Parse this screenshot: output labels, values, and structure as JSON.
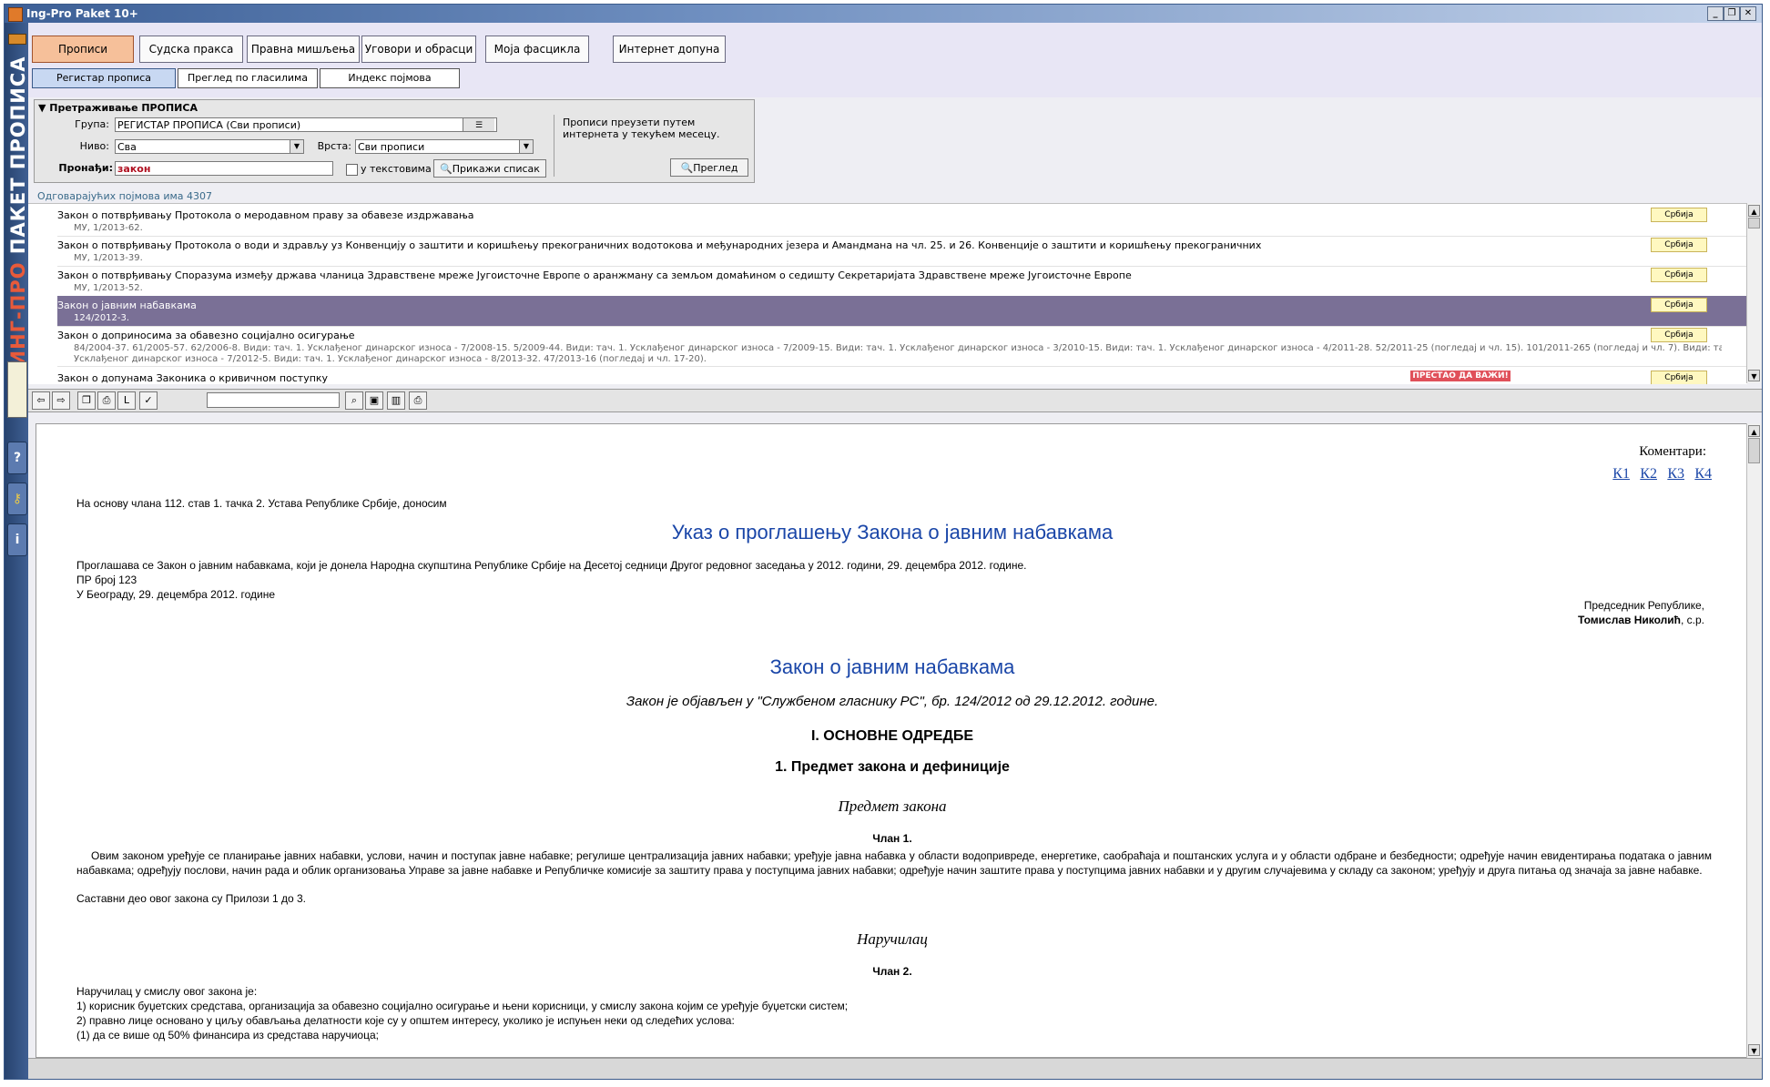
{
  "window": {
    "title": "Ing-Pro Paket 10+"
  },
  "sidebar": {
    "brand_part1": "ИНГ-ПРО",
    "brand_part2": " ПАКЕТ ПРОПИСА"
  },
  "main_tabs": [
    "Прописи",
    "Судска пракса",
    "Правна мишљења",
    "Уговори и обрасци",
    "Моја фасцикла",
    "Интернет допуна"
  ],
  "sub_tabs": [
    "Регистар прописа",
    "Преглед по гласилима",
    "Индекс појмова"
  ],
  "search": {
    "header": "Претраживање ПРОПИСА",
    "group_label": "Група:",
    "group_value": "РЕГИСТАР ПРОПИСА (Сви прописи)",
    "level_label": "Ниво:",
    "level_value": "Сва",
    "type_label": "Врста:",
    "type_value": "Сви прописи",
    "find_label": "Пронађи:",
    "find_value": "закон",
    "in_texts_label": "у текстовима",
    "show_list_button": "Прикажи списак",
    "note": "Прописи преузети путем интернета у текућем месецу.",
    "preview_button": "Преглед"
  },
  "result_count": "Одговарајућих појмова има 4307",
  "results": [
    {
      "title": "Закон о потврђивању Протокола о меродавном праву за обавезе издржавања",
      "ref": "МУ, 1/2013-62.",
      "region": "Србија"
    },
    {
      "title": "Закон о потврђивању Протокола о води и здрављу уз Конвенцију о заштити и коришћењу прекограничних водотокова и међународних језера и Амандмана на чл. 25. и 26. Конвенције о заштити и коришћењу прекограничних",
      "ref": "МУ, 1/2013-39.",
      "region": "Србија"
    },
    {
      "title": "Закон о потврђивању Споразума између држава чланица Здравствене мреже Југоисточне Европе о аранжману са земљом домаћином о седишту Секретаријата Здравствене мреже Југоисточне Европе",
      "ref": "МУ, 1/2013-52.",
      "region": "Србија"
    },
    {
      "title": "Закон о јавним набавкама",
      "ref": "124/2012-3.",
      "region": "Србија"
    },
    {
      "title": "Закон о доприносима за обавезно социјално осигурање",
      "ref": "84/2004-37. 61/2005-57. 62/2006-8. Види: тач. 1. Усклађеног динарског износа - 7/2008-15. 5/2009-44. Види: тач. 1. Усклађеног динарског износа - 7/2009-15. Види: тач. 1. Усклађеног динарског износа - 3/2010-15. Види: тач. 1. Усклађеног динарског износа - 4/2011-28. 52/2011-25 (погледај и чл. 15). 101/2011-265 (погледај и чл. 7). Види: тач. 1.",
      "ref2": "Усклађеног динарског износа - 7/2012-5. Види: тач. 1. Усклађеног динарског износа - 8/2013-32. 47/2013-16 (погледај и чл. 17-20).",
      "region": "Србија"
    },
    {
      "title": "Закон о допунама Законика о кривичном поступку",
      "ref": "",
      "region": "Србија",
      "status": "ПРЕСТАО ДА ВАЖИ!"
    }
  ],
  "toolbar_labels": {
    "arrow_back": "⇦",
    "arrow_fwd": "⇨",
    "l_button": "L"
  },
  "document": {
    "comments_label": "Коментари:",
    "comment_links": [
      "К1",
      "К2",
      "К3",
      "К4"
    ],
    "preamble": "На основу члана 112. став 1. тачка 2. Устава Републике Србије, доносим",
    "decree_title": "Указ о проглашењу Закона о јавним набавкама",
    "decree_line1": "Проглашава се Закон о јавним набавкама, који је донела Народна скупштина Републике Србије на Десетој седници Другог редовног заседања у 2012. години, 29. децембра 2012. године.",
    "decree_line2": "ПР број 123",
    "decree_line3": "У Београду, 29. децембра 2012. године",
    "president_title": "Председник Републике,",
    "president_name": "Томислав Николић",
    "president_suffix": ", с.р.",
    "law_title": "Закон о јавним набавкама",
    "published": "Закон је објављен у \"Службеном гласнику РС\", бр. 124/2012 од 29.12.2012. године.",
    "part_heading": "I. ОСНОВНЕ ОДРЕДБЕ",
    "chapter_heading": "1. Предмет закона и дефиниције",
    "sub1": "Предмет закона",
    "art1": "Члан 1.",
    "art1_text": "Овим законом уређује се планирање јавних набавки, услови, начин и поступак јавне набавке; регулише централизација јавних набавки; уређује јавна набавка у области водопривреде, енергетике, саобраћаја и поштанских услуга и у области одбране и безбедности; одређује начин евидентирања података о јавним набавкама; одређују послови, начин рада и облик организовања Управе за јавне набавке и Републичке комисије за заштиту права у поступцима јавних набавки; одређује начин заштите права у поступцима јавних набавки и у другим случајевима у складу са законом; уређују и друга питања од значаја за јавне набавке.",
    "art1_text2": "Саставни део овог закона су Прилози 1 до 3.",
    "sub2": "Наручилац",
    "art2": "Члан 2.",
    "art2_line1": "Наручилац у смислу овог закона је:",
    "art2_line2": "1) корисник буџетских средстава, организација за обавезно социјално осигурање и њени корисници, у смислу закона којим се уређује буџетски систем;",
    "art2_line3": "2) правно лице основано у циљу обављања делатности које су у општем интересу, уколико је испуњен неки од следећих услова:",
    "art2_line4": "(1) да се више од 50% финансира из средстава наручиоца;"
  }
}
